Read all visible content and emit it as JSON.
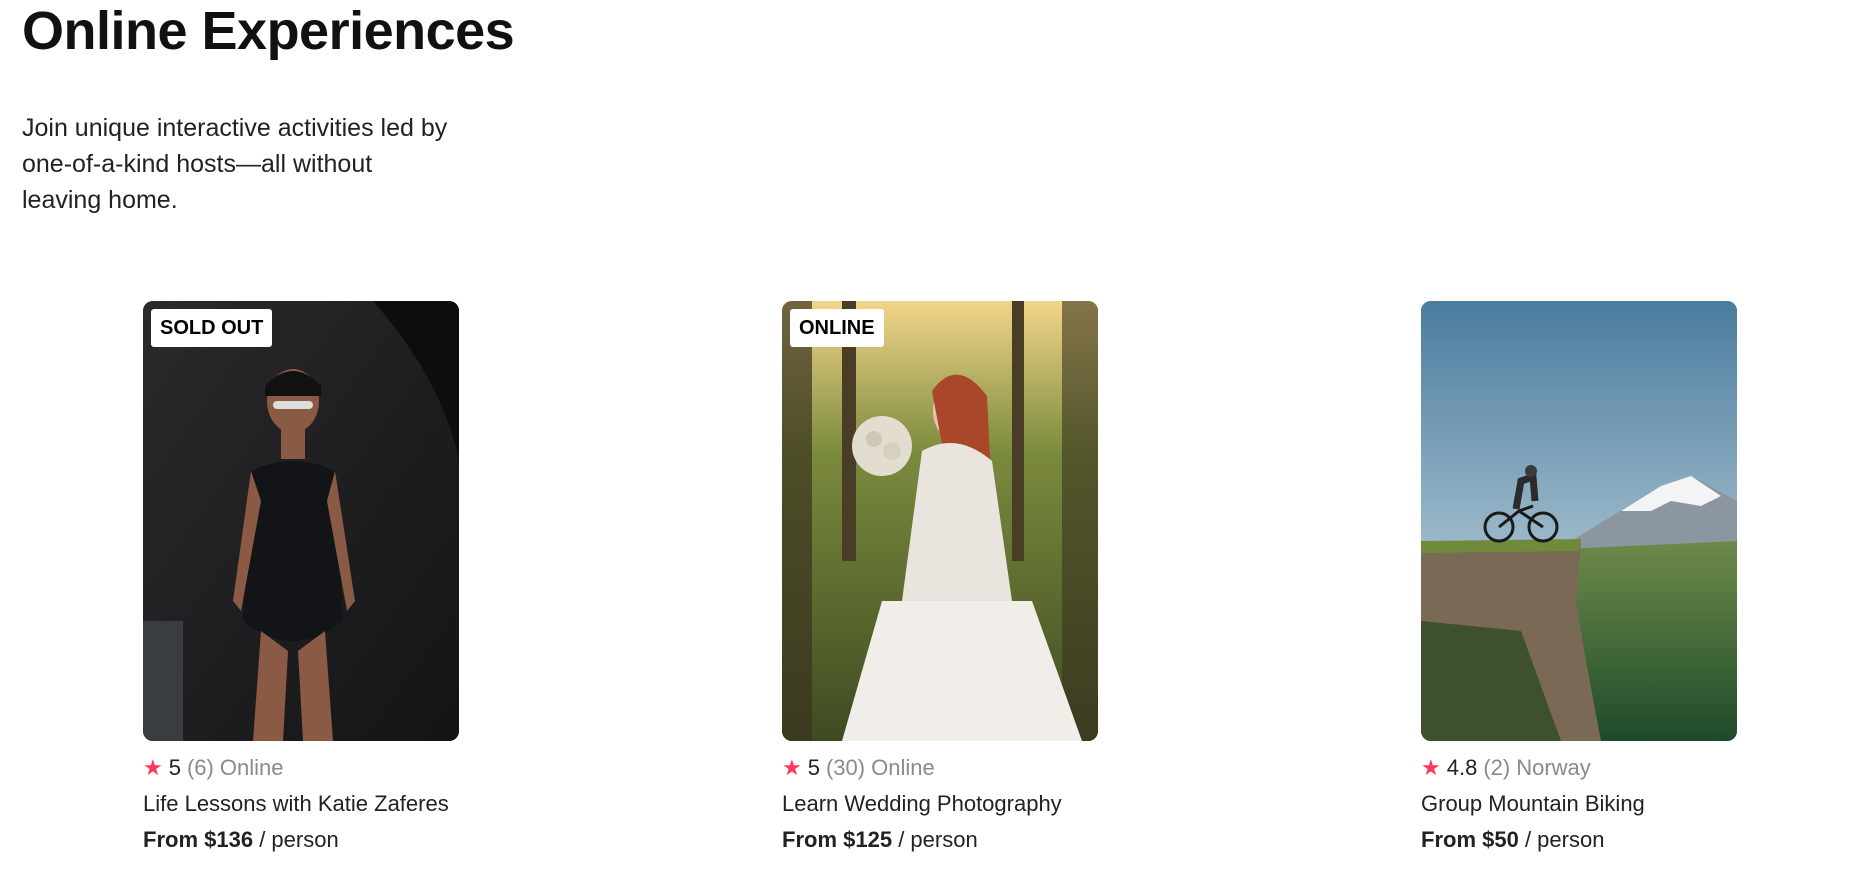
{
  "page": {
    "title": "Online Experiences",
    "subtitle": "Join unique interactive activities led by one-of-a-kind hosts—all without leaving home."
  },
  "colors": {
    "accent_star": "#ff385c",
    "muted_text": "#8a8a8a"
  },
  "cards": [
    {
      "badge": "SOLD OUT",
      "rating": "5",
      "reviews": "(6)",
      "location": "Online",
      "title": "Life Lessons with Katie Zaferes",
      "price_prefix": "From $136",
      "price_suffix": "/ person",
      "image_desc_icon": "swimmer-photo"
    },
    {
      "badge": "ONLINE",
      "rating": "5",
      "reviews": "(30)",
      "location": "Online",
      "title": "Learn Wedding Photography",
      "price_prefix": "From $125",
      "price_suffix": "/ person",
      "image_desc_icon": "bride-photo"
    },
    {
      "badge": "",
      "rating": "4.8",
      "reviews": "(2)",
      "location": "Norway",
      "title": "Group Mountain Biking",
      "price_prefix": "From $50",
      "price_suffix": "/ person",
      "image_desc_icon": "mountain-biker-photo"
    }
  ]
}
